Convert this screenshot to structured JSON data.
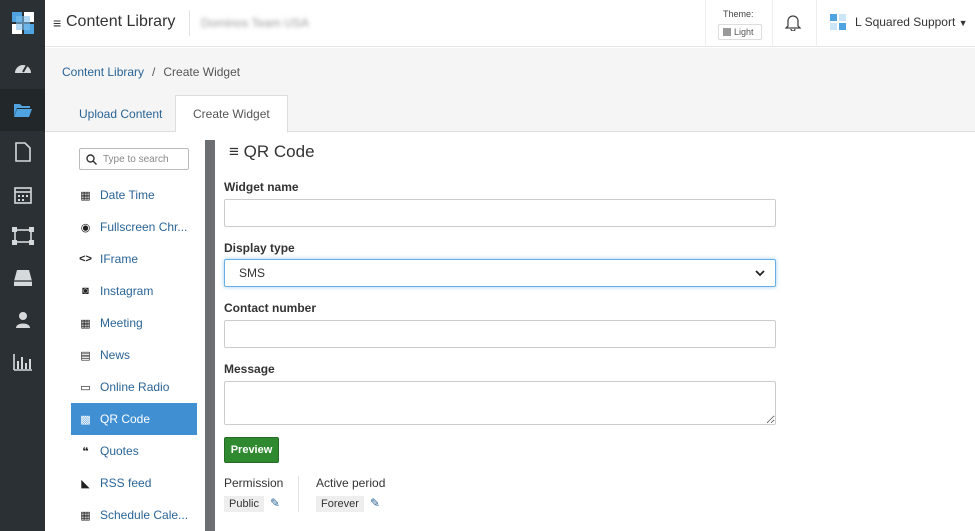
{
  "header": {
    "menu_icon": "hamburger-icon",
    "app_title": "Content Library",
    "org_name": "Dominos Team USA",
    "theme_label": "Theme:",
    "theme_value": "Light",
    "user_name": "L Squared Support"
  },
  "rail": {
    "items": [
      "dashboard-icon",
      "folder-icon",
      "page-icon",
      "calendar-icon",
      "display-network-icon",
      "player-icon",
      "user-icon",
      "reports-icon"
    ]
  },
  "breadcrumb": {
    "root": "Content Library",
    "separator": "/",
    "current": "Create Widget"
  },
  "tabs": {
    "upload": "Upload Content",
    "create": "Create Widget"
  },
  "widget_list": {
    "search_placeholder": "Type to search",
    "items": [
      {
        "label": "Date Time",
        "icon": "calendar-clock-icon",
        "glyph": "▦"
      },
      {
        "label": "Fullscreen Chr...",
        "icon": "chrome-icon",
        "glyph": "◉"
      },
      {
        "label": "IFrame",
        "icon": "code-icon",
        "glyph": "<>"
      },
      {
        "label": "Instagram",
        "icon": "instagram-icon",
        "glyph": "◙"
      },
      {
        "label": "Meeting",
        "icon": "calendar-icon",
        "glyph": "▦"
      },
      {
        "label": "News",
        "icon": "newspaper-icon",
        "glyph": "▤"
      },
      {
        "label": "Online Radio",
        "icon": "radio-icon",
        "glyph": "▭"
      },
      {
        "label": "QR Code",
        "icon": "qrcode-icon",
        "glyph": "▩"
      },
      {
        "label": "Quotes",
        "icon": "quote-icon",
        "glyph": "❝"
      },
      {
        "label": "RSS feed",
        "icon": "rss-icon",
        "glyph": "◣"
      },
      {
        "label": "Schedule Cale...",
        "icon": "schedule-icon",
        "glyph": "▦"
      }
    ],
    "active_index": 7
  },
  "form": {
    "heading_icon": "≡",
    "heading": "QR Code",
    "widget_name_label": "Widget name",
    "widget_name_value": "",
    "display_type_label": "Display type",
    "display_type_value": "SMS",
    "contact_label": "Contact number",
    "contact_value": "",
    "message_label": "Message",
    "message_value": "",
    "preview_label": "Preview",
    "permission_label": "Permission",
    "permission_value": "Public",
    "active_period_label": "Active period",
    "active_period_value": "Forever"
  },
  "colors": {
    "rail_bg": "#2b3034",
    "accent": "#3f8fd2",
    "link": "#2a6496",
    "preview_btn": "#2f8a2f"
  }
}
